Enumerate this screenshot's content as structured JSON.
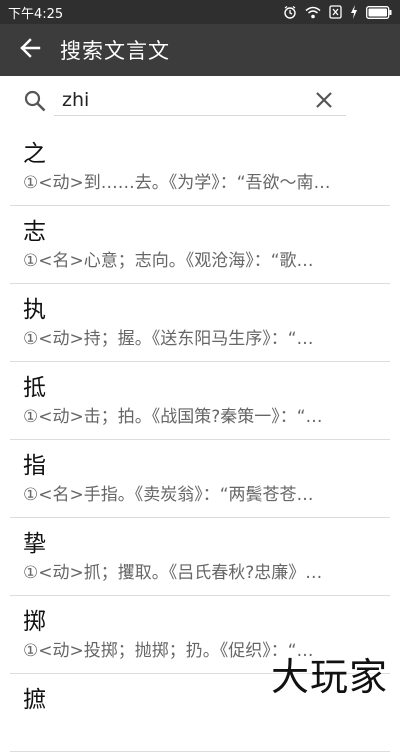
{
  "status_bar": {
    "time": "下午4:25",
    "icons": [
      "alarm-icon",
      "wifi-icon",
      "sim-icon",
      "charging-icon",
      "battery-icon"
    ]
  },
  "toolbar": {
    "back_icon": "arrow-left-icon",
    "title": "搜索文言文"
  },
  "search": {
    "value": "zhi",
    "search_icon": "search-icon",
    "clear_icon": "close-icon"
  },
  "results": [
    {
      "word": "之",
      "definition": "①<动>到……去。《为学》：“吾欲～南…"
    },
    {
      "word": "志",
      "definition": "①<名>心意；志向。《观沧海》：“歌…"
    },
    {
      "word": "执",
      "definition": "①<动>持；握。《送东阳马生序》：“…"
    },
    {
      "word": "抵",
      "definition": "①<动>击；拍。《战国策?秦策一》：“…"
    },
    {
      "word": "指",
      "definition": "①<名>手指。《卖炭翁》：“两鬓苍苍…"
    },
    {
      "word": "挚",
      "definition": "①<动>抓；攫取。《吕氏春秋?忠廉》…"
    },
    {
      "word": "掷",
      "definition": "①<动>投掷；抛掷；扔。《促织》：“…"
    },
    {
      "word": "摭",
      "definition": ""
    }
  ],
  "watermark": "大玩家",
  "colors": {
    "status_bar": "#2f2f2f",
    "toolbar": "#3c3c3c",
    "divider": "#dcdcdc"
  }
}
